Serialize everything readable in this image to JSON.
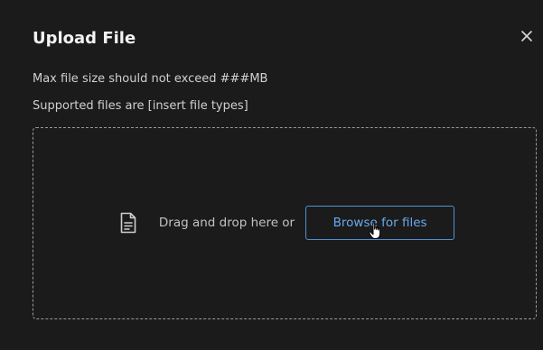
{
  "dialog": {
    "title": "Upload File",
    "close_icon": "close-icon",
    "info_lines": [
      "Max file size should not exceed ###MB",
      "Supported files are [insert file types]"
    ]
  },
  "dropzone": {
    "icon": "document-icon",
    "prompt": "Drag and drop here or",
    "browse_label": "Browse for files"
  },
  "colors": {
    "background": "#1b1b1b",
    "accent": "#4f8fd1",
    "accent_text": "#69a9ec"
  }
}
